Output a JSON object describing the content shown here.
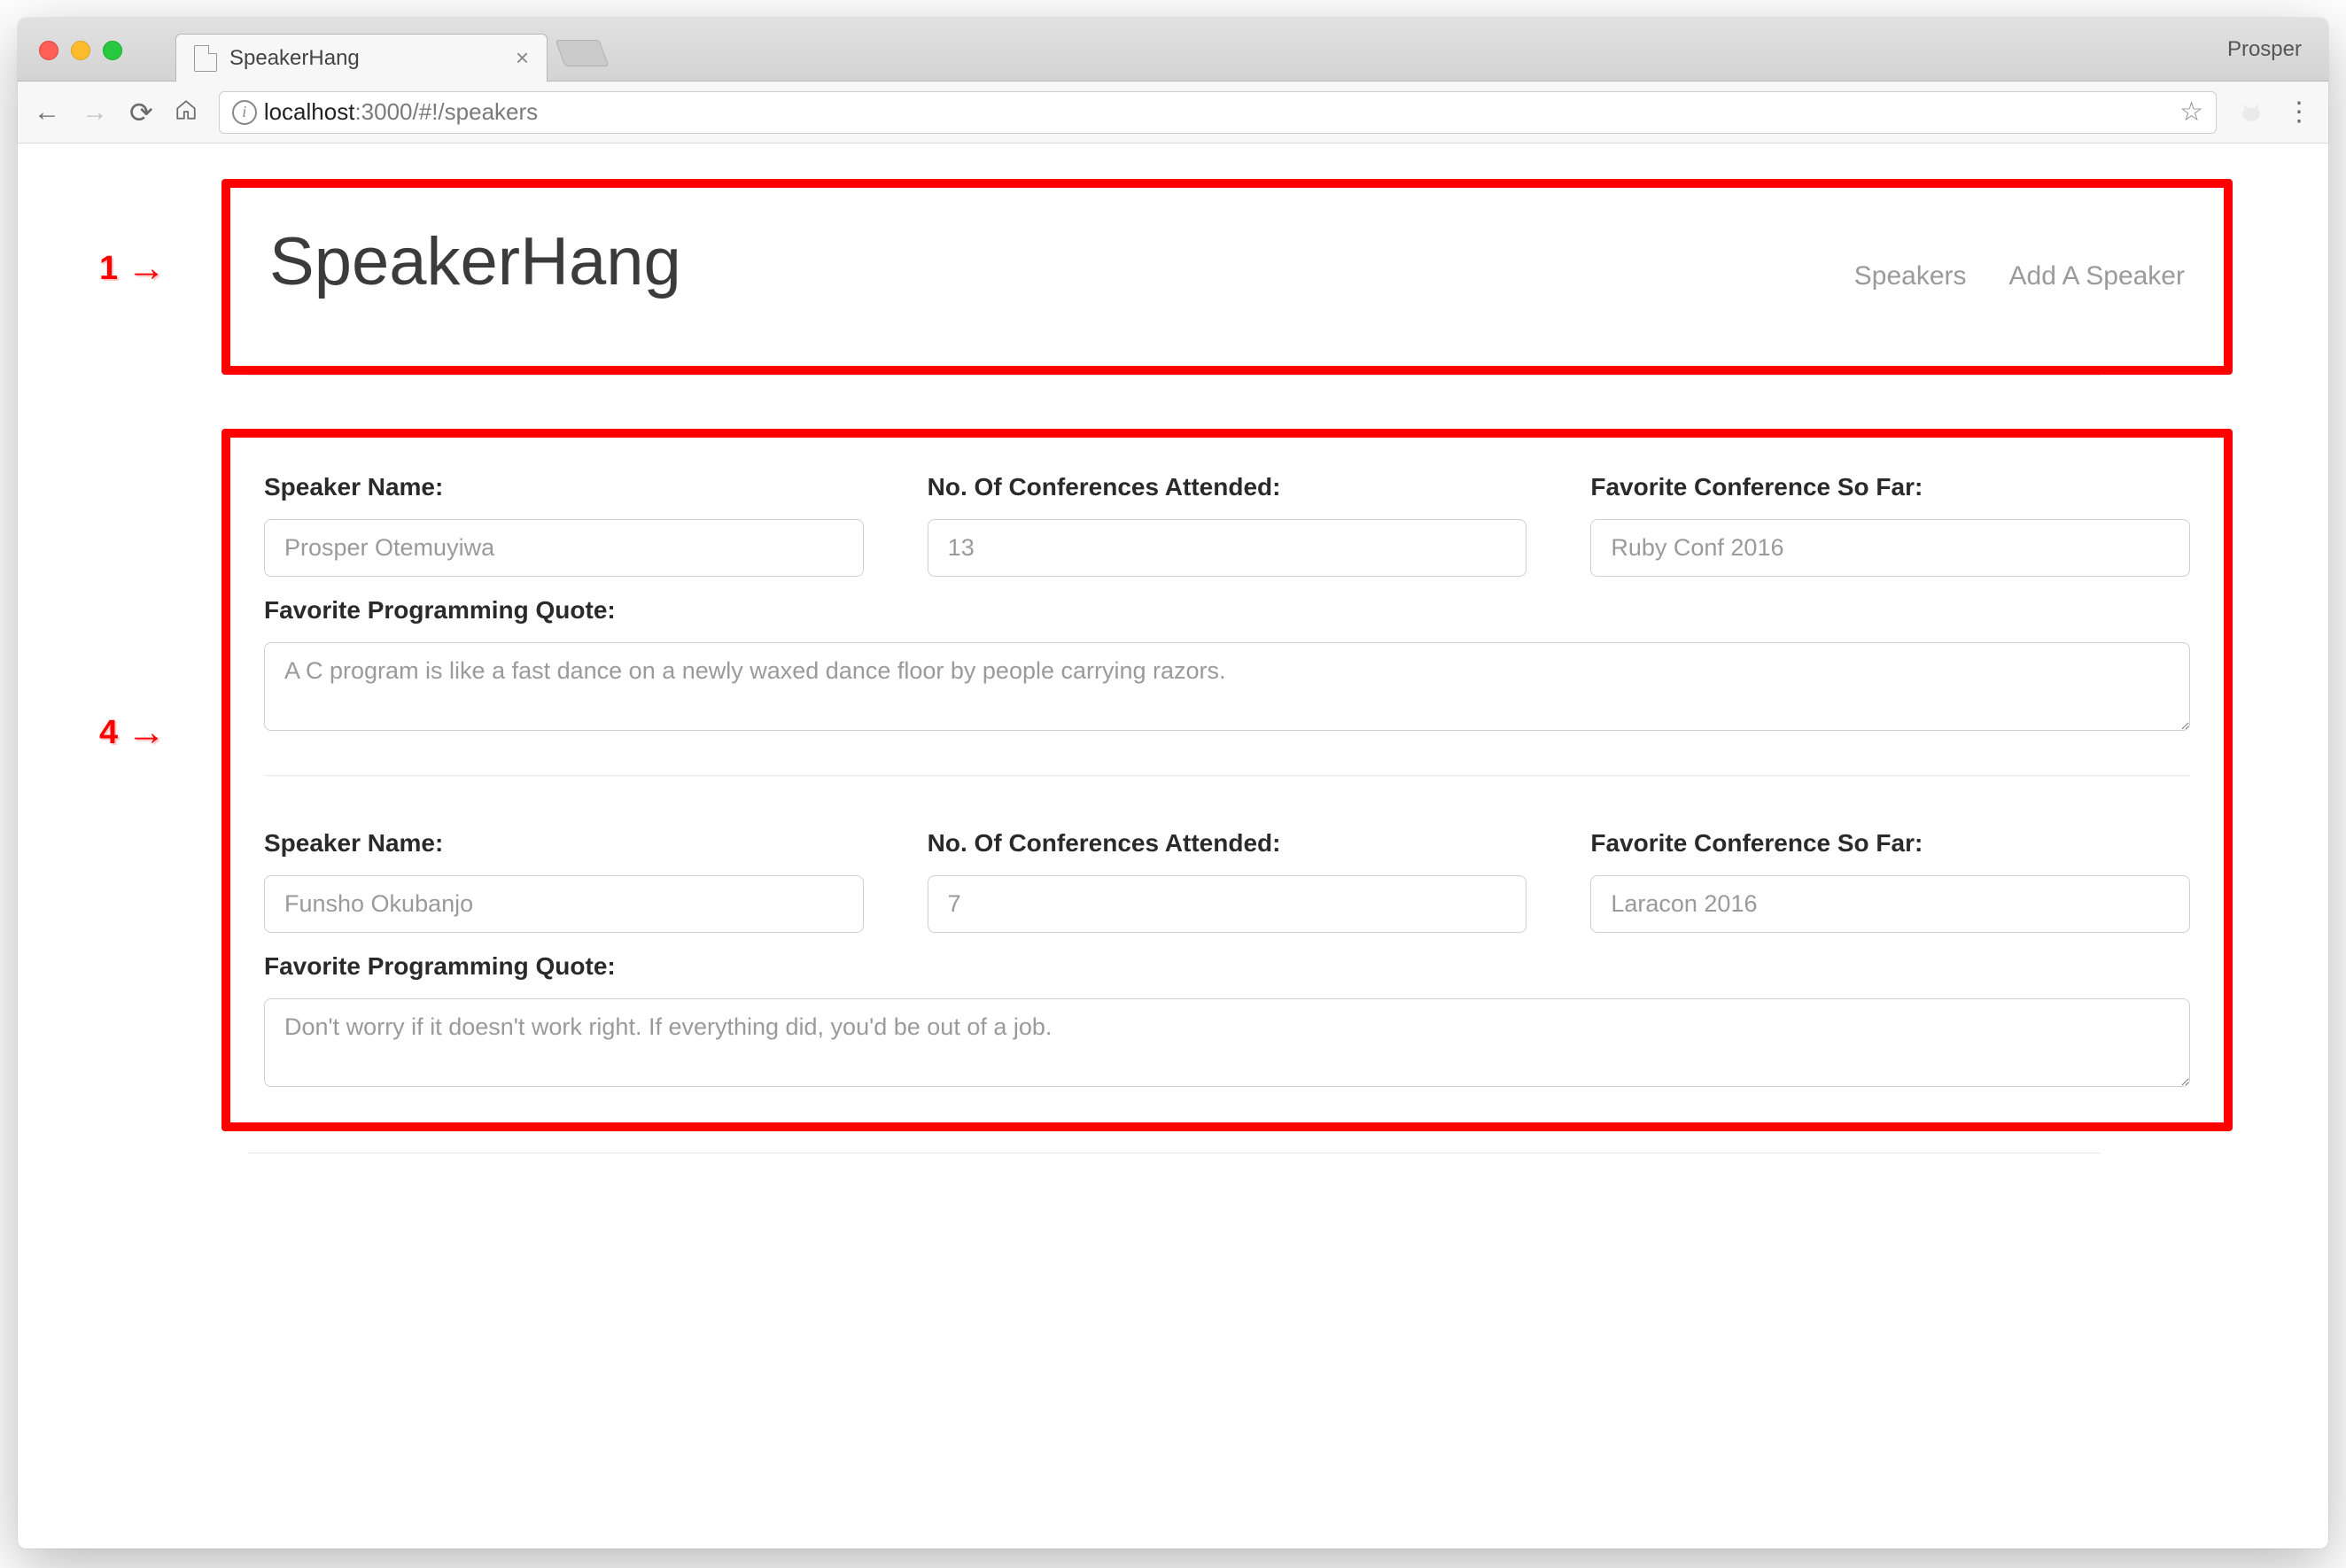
{
  "browser": {
    "tab_title": "SpeakerHang",
    "profile_name": "Prosper",
    "url_host": "localhost",
    "url_port": ":3000",
    "url_path": "/#!/speakers"
  },
  "annotations": {
    "one": "1",
    "four": "4"
  },
  "navbar": {
    "brand": "SpeakerHang",
    "links": {
      "speakers": "Speakers",
      "add": "Add A Speaker"
    }
  },
  "labels": {
    "name": "Speaker Name:",
    "conf_count": "No. Of Conferences Attended:",
    "fav_conf": "Favorite Conference So Far:",
    "fav_quote": "Favorite Programming Quote:"
  },
  "speakers": [
    {
      "name": "Prosper Otemuyiwa",
      "conf_count": "13",
      "fav_conf": "Ruby Conf 2016",
      "quote": "A C program is like a fast dance on a newly waxed dance floor by people carrying razors."
    },
    {
      "name": "Funsho Okubanjo",
      "conf_count": "7",
      "fav_conf": "Laracon 2016",
      "quote": "Don't worry if it doesn't work right. If everything did, you'd be out of a job."
    }
  ]
}
